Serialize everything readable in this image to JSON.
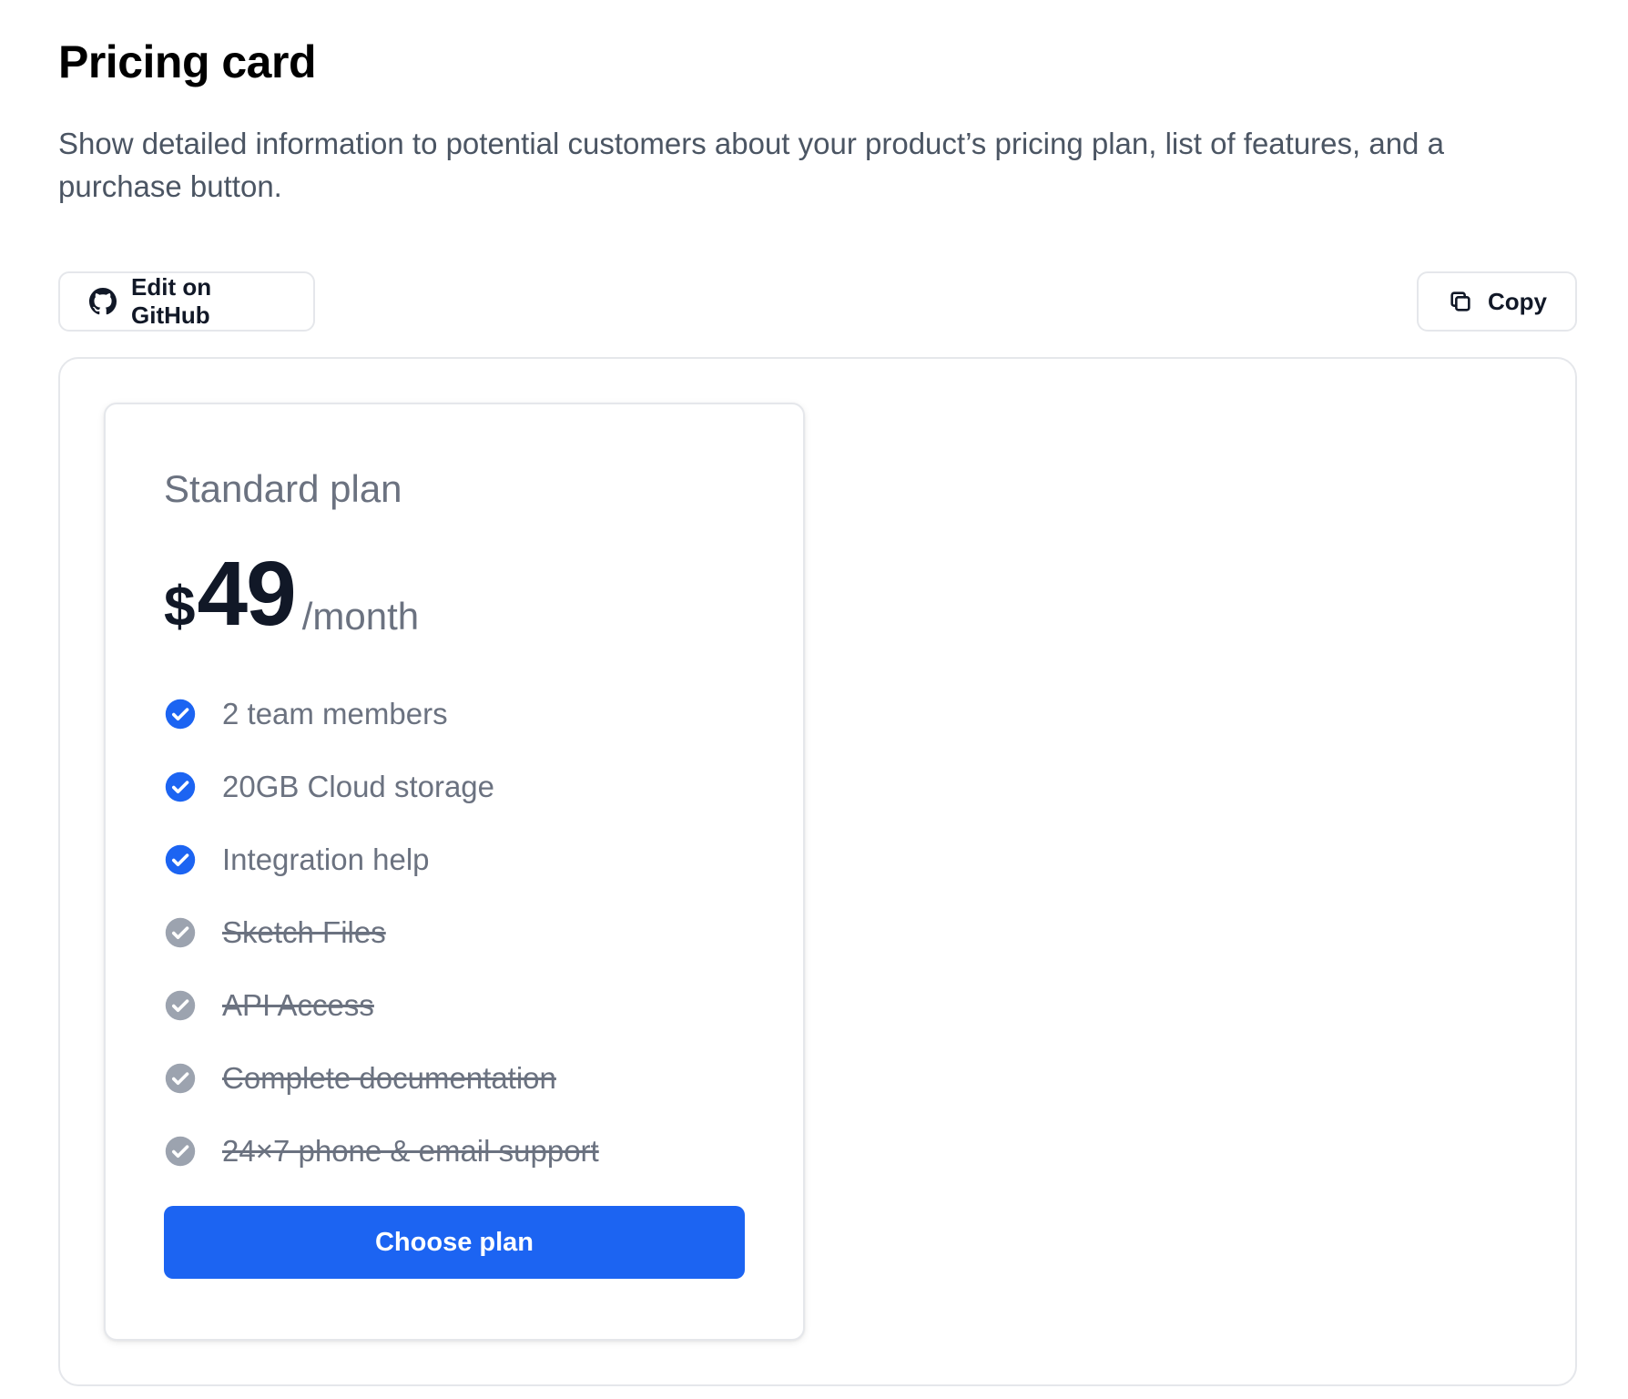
{
  "header": {
    "title": "Pricing card",
    "description": "Show detailed information to potential customers about your product’s pricing plan, list of features, and a purchase button."
  },
  "toolbar": {
    "github_label": "Edit on GitHub",
    "copy_label": "Copy"
  },
  "card": {
    "plan_name": "Standard plan",
    "currency": "$",
    "price": "49",
    "period": "/month",
    "features": [
      {
        "label": "2 team members",
        "included": true
      },
      {
        "label": "20GB Cloud storage",
        "included": true
      },
      {
        "label": "Integration help",
        "included": true
      },
      {
        "label": "Sketch Files",
        "included": false
      },
      {
        "label": "API Access",
        "included": false
      },
      {
        "label": "Complete documentation",
        "included": false
      },
      {
        "label": "24×7 phone & email support",
        "included": false
      }
    ],
    "cta_label": "Choose plan"
  },
  "colors": {
    "accent": "#1c64f2",
    "check_included": "#1c64f2",
    "check_excluded": "#9ca3af"
  },
  "icons": {
    "github": "github-icon",
    "copy": "copy-icon",
    "included": "check-circle-icon",
    "excluded": "check-circle-icon"
  }
}
